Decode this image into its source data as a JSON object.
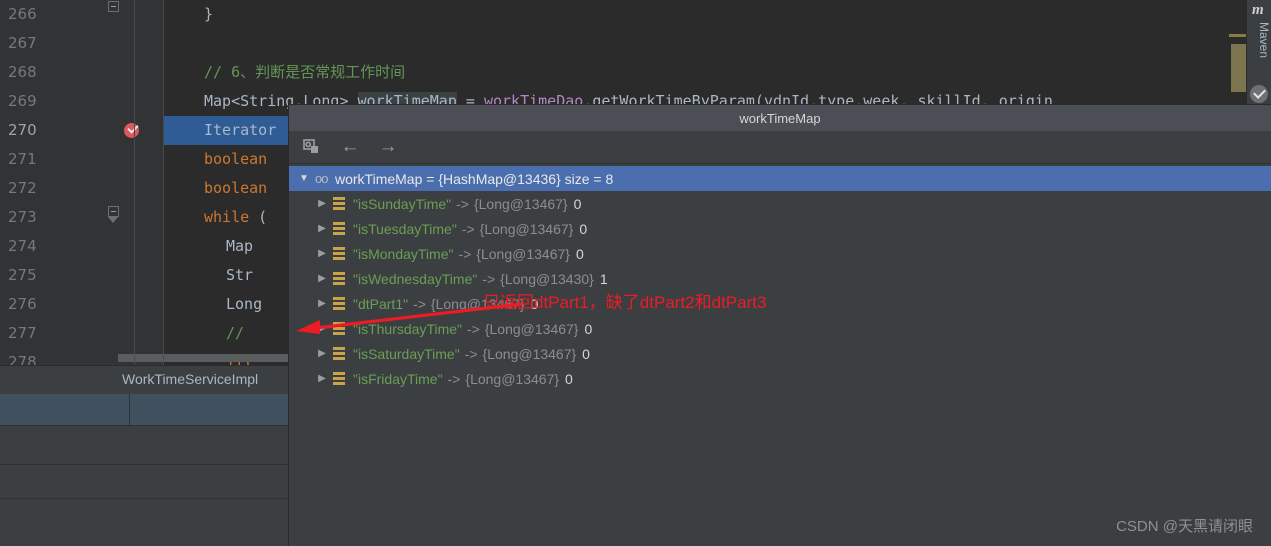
{
  "editor": {
    "lines": [
      {
        "num": "266",
        "tokens": [
          {
            "t": "plain",
            "s": "}"
          }
        ],
        "indent": 40,
        "fold": "minus-top",
        "highlight": false
      },
      {
        "num": "267",
        "tokens": [],
        "indent": 40,
        "highlight": false
      },
      {
        "num": "268",
        "tokens": [
          {
            "t": "cmt",
            "s": "// 6、判断是否常规工作时间"
          }
        ],
        "indent": 40,
        "highlight": false
      },
      {
        "num": "269",
        "tokens": [
          {
            "t": "plain",
            "s": "Map<String,"
          },
          {
            "t": "plain",
            "s": "Long> "
          },
          {
            "t": "ident-hl",
            "s": "workTimeMap"
          },
          {
            "t": "plain",
            "s": " = "
          },
          {
            "t": "method",
            "s": "workTimeDao"
          },
          {
            "t": "plain",
            "s": ".getWorkTimeByParam("
          },
          {
            "t": "plain",
            "s": "vdnId"
          },
          {
            "t": "comma",
            "s": ","
          },
          {
            "t": "plain",
            "s": "type"
          },
          {
            "t": "comma",
            "s": ","
          },
          {
            "t": "plain",
            "s": "week"
          },
          {
            "t": "comma",
            "s": ","
          },
          {
            "t": "plain",
            "s": " skillId"
          },
          {
            "t": "comma",
            "s": ","
          },
          {
            "t": "plain",
            "s": " origin"
          }
        ],
        "indent": 40,
        "highlight": false
      },
      {
        "num": "270",
        "tokens": [
          {
            "t": "plain",
            "s": "Iterator"
          }
        ],
        "indent": 40,
        "highlight": true,
        "breakpoint": true
      },
      {
        "num": "271",
        "tokens": [
          {
            "t": "kw",
            "s": "boolean"
          }
        ],
        "indent": 40,
        "highlight": false
      },
      {
        "num": "272",
        "tokens": [
          {
            "t": "kw",
            "s": "boolean"
          }
        ],
        "indent": 40,
        "highlight": false
      },
      {
        "num": "273",
        "tokens": [
          {
            "t": "kw",
            "s": "while"
          },
          {
            "t": "plain",
            "s": " ("
          }
        ],
        "indent": 40,
        "highlight": false,
        "fold": "minus-tail"
      },
      {
        "num": "274",
        "tokens": [
          {
            "t": "plain",
            "s": "Map"
          }
        ],
        "indent": 62,
        "highlight": false
      },
      {
        "num": "275",
        "tokens": [
          {
            "t": "plain",
            "s": "Str"
          }
        ],
        "indent": 62,
        "highlight": false
      },
      {
        "num": "276",
        "tokens": [
          {
            "t": "plain",
            "s": "Long"
          }
        ],
        "indent": 62,
        "highlight": false
      },
      {
        "num": "277",
        "tokens": [
          {
            "t": "cmt",
            "s": "//"
          }
        ],
        "indent": 62,
        "highlight": false
      },
      {
        "num": "278",
        "tokens": [
          {
            "t": "kw",
            "s": "if("
          }
        ],
        "indent": 62,
        "highlight": false
      }
    ],
    "breadcrumb": "WorkTimeServiceImpl"
  },
  "right_stripe": {
    "maven_label": "Maven",
    "logo_letter": "m",
    "badge_icon": "check-badge-icon"
  },
  "popup": {
    "title": "workTimeMap",
    "toolbar": {
      "inspect_icon": "inspect-icon",
      "back_icon": "arrow-left-icon",
      "forward_icon": "arrow-right-icon",
      "back_glyph": "←",
      "forward_glyph": "→"
    },
    "tree": {
      "root": {
        "expander": "▼",
        "icon": "map-icon",
        "icon_glyph": "oo",
        "text": "workTimeMap = {HashMap@13436}  size = 8"
      },
      "children": [
        {
          "expander": "▶",
          "icon": "field-icon",
          "name": "\"isSundayTime\"",
          "arrow": "->",
          "type": "{Long@13467}",
          "value": "0"
        },
        {
          "expander": "▶",
          "icon": "field-icon",
          "name": "\"isTuesdayTime\"",
          "arrow": "->",
          "type": "{Long@13467}",
          "value": "0"
        },
        {
          "expander": "▶",
          "icon": "field-icon",
          "name": "\"isMondayTime\"",
          "arrow": "->",
          "type": "{Long@13467}",
          "value": "0"
        },
        {
          "expander": "▶",
          "icon": "field-icon",
          "name": "\"isWednesdayTime\"",
          "arrow": "->",
          "type": "{Long@13430}",
          "value": "1"
        },
        {
          "expander": "▶",
          "icon": "field-icon",
          "name": "\"dtPart1\"",
          "arrow": "->",
          "type": "{Long@13467}",
          "value": "0"
        },
        {
          "expander": "▶",
          "icon": "field-icon",
          "name": "\"isThursdayTime\"",
          "arrow": "->",
          "type": "{Long@13467}",
          "value": "0"
        },
        {
          "expander": "▶",
          "icon": "field-icon",
          "name": "\"isSaturdayTime\"",
          "arrow": "->",
          "type": "{Long@13467}",
          "value": "0"
        },
        {
          "expander": "▶",
          "icon": "field-icon",
          "name": "\"isFridayTime\"",
          "arrow": "->",
          "type": "{Long@13467}",
          "value": "0"
        }
      ]
    }
  },
  "annotation": {
    "text": "只返回dtPart1，缺了dtPart2和dtPart3",
    "color": "#ee1b24"
  },
  "watermark": {
    "text": "CSDN @天黑请闭眼"
  },
  "colors": {
    "editor_bg": "#2b2b2b",
    "gutter_bg": "#313335",
    "panel_bg": "#3c3f41",
    "title_bg": "#4b4e54",
    "selection_blue": "#4b6eaf",
    "line_highlight": "#2f5c94",
    "string_green": "#6a9e54",
    "comment_green": "#629755",
    "keyword_orange": "#cc7832"
  }
}
